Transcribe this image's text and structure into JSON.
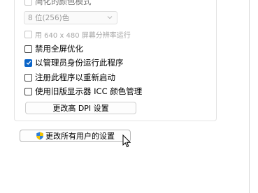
{
  "settings": {
    "reduced_color_mode_label": "简化的颜色模式",
    "color_depth_value": "8 位(256)色",
    "resolution_640_label": "用 640 x 480 屏幕分辨率运行",
    "disable_fullscreen_opt_label": "禁用全屏优化",
    "run_as_admin_label": "以管理员身份运行此程序",
    "register_restart_label": "注册此程序以重新启动",
    "legacy_icc_label": "使用旧版显示器 ICC 颜色管理",
    "change_dpi_label": "更改高 DPI 设置"
  },
  "footer": {
    "change_all_users_label": "更改所有用户的设置"
  },
  "states": {
    "reduced_color_mode": false,
    "resolution_640": false,
    "disable_fullscreen_opt": false,
    "run_as_admin": true,
    "register_restart": false,
    "legacy_icc": false
  },
  "colors": {
    "checked_accent": "#0a64c8",
    "shield_blue": "#2f7fd6",
    "shield_yellow": "#f2c200"
  },
  "icons": {
    "check": "checkmark-icon",
    "dropdown": "chevron-down-icon",
    "uac": "uac-shield-icon",
    "pointer": "mouse-pointer-icon"
  }
}
